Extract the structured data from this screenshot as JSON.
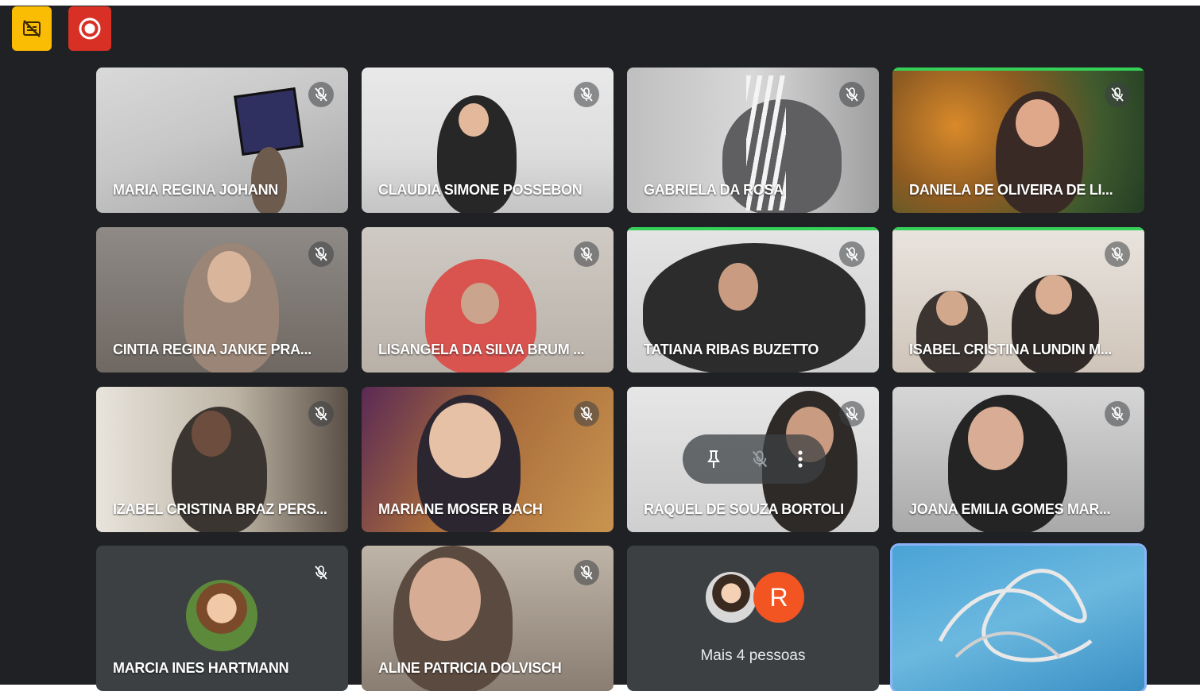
{
  "toolbar": {
    "captions_icon": "closed-captions-off-icon",
    "record_icon": "recording-icon"
  },
  "colors": {
    "background": "#202124",
    "tile": "#3c4043",
    "speaking": "#34d058",
    "record": "#d93025",
    "captions": "#fbbc04"
  },
  "participants": [
    {
      "name": "MARIA REGINA JOHANN",
      "muted": true
    },
    {
      "name": "CLAUDIA SIMONE POSSEBON",
      "muted": true
    },
    {
      "name": "GABRIELA DA ROSA",
      "muted": true
    },
    {
      "name": "DANIELA DE OLIVEIRA DE LI...",
      "muted": true
    },
    {
      "name": "CINTIA REGINA JANKE PRA...",
      "muted": true
    },
    {
      "name": "LISANGELA DA SILVA BRUM ...",
      "muted": true
    },
    {
      "name": "TATIANA RIBAS BUZETTO",
      "muted": true
    },
    {
      "name": "ISABEL CRISTINA LUNDIN M...",
      "muted": true
    },
    {
      "name": "IZABEL CRISTINA BRAZ PERS...",
      "muted": true
    },
    {
      "name": "MARIANE MOSER BACH",
      "muted": true
    },
    {
      "name": "RAQUEL DE SOUZA BORTOLI",
      "muted": true
    },
    {
      "name": "JOANA EMILIA GOMES MAR...",
      "muted": true
    },
    {
      "name": "MARCIA INES HARTMANN",
      "muted": true
    },
    {
      "name": "ALINE PATRICIA DOLVISCH",
      "muted": true
    }
  ],
  "more_people": {
    "avatar_letter": "R",
    "label": "Mais 4 pessoas"
  }
}
